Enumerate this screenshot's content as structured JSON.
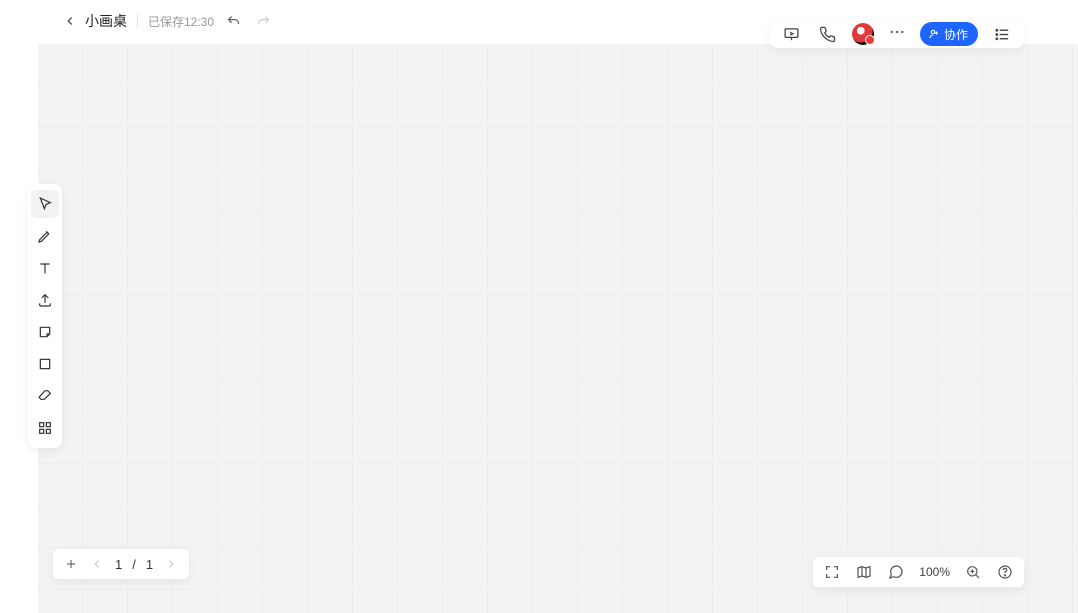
{
  "header": {
    "doc_title": "小画桌",
    "save_status": "已保存12:30"
  },
  "topright": {
    "collab_label": "协作"
  },
  "tool_palette": {
    "items": [
      {
        "name": "cursor-icon"
      },
      {
        "name": "pen-icon"
      },
      {
        "name": "text-icon"
      },
      {
        "name": "upload-icon"
      },
      {
        "name": "sticky-icon"
      },
      {
        "name": "shape-icon"
      },
      {
        "name": "eraser-icon"
      },
      {
        "name": "apps-icon"
      }
    ],
    "selected_index": 0
  },
  "pager": {
    "current": "1",
    "separator": "/",
    "total": "1"
  },
  "bottomright": {
    "zoom_label": "100%"
  }
}
